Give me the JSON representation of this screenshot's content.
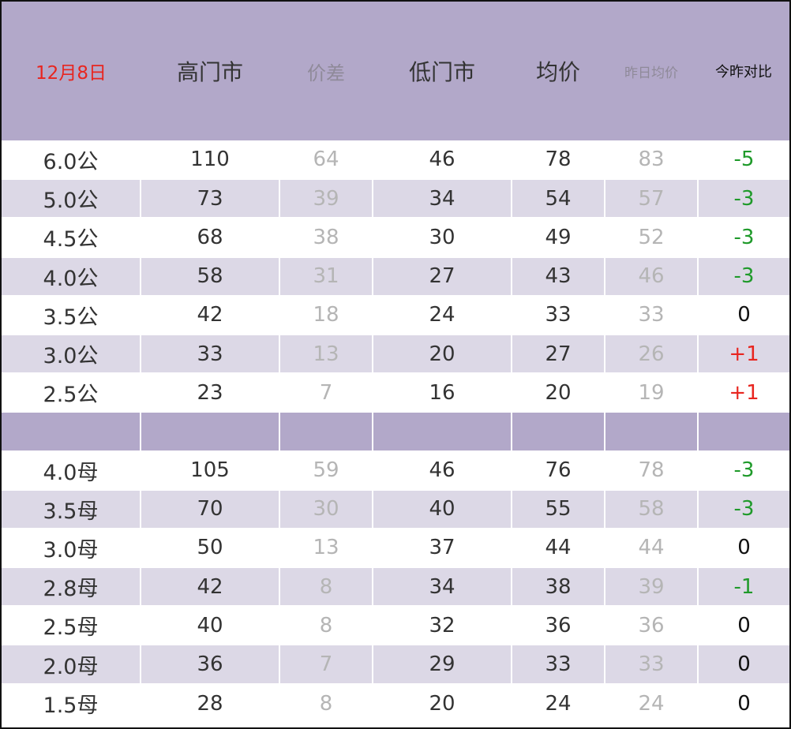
{
  "header": {
    "date": "12月8日",
    "high_market": "高门市",
    "price_diff": "价差",
    "low_market": "低门市",
    "average": "均价",
    "yesterday_avg": "昨日均价",
    "today_vs_yesterday": "今昨对比"
  },
  "colors": {
    "header_bg": "#b2a8c9",
    "alt_row_bg": "#dcd8e6",
    "date_red": "#e8251f",
    "decrease_green": "#1f9a2a",
    "increase_red": "#e8251f",
    "muted_gray": "#b5b5b5"
  },
  "male_rows": [
    {
      "spec": "6.0公",
      "high": "110",
      "diff": "64",
      "low": "46",
      "avg": "78",
      "yesterday": "83",
      "change": "-5",
      "trend": "down"
    },
    {
      "spec": "5.0公",
      "high": "73",
      "diff": "39",
      "low": "34",
      "avg": "54",
      "yesterday": "57",
      "change": "-3",
      "trend": "down"
    },
    {
      "spec": "4.5公",
      "high": "68",
      "diff": "38",
      "low": "30",
      "avg": "49",
      "yesterday": "52",
      "change": "-3",
      "trend": "down"
    },
    {
      "spec": "4.0公",
      "high": "58",
      "diff": "31",
      "low": "27",
      "avg": "43",
      "yesterday": "46",
      "change": "-3",
      "trend": "down"
    },
    {
      "spec": "3.5公",
      "high": "42",
      "diff": "18",
      "low": "24",
      "avg": "33",
      "yesterday": "33",
      "change": "0",
      "trend": "flat"
    },
    {
      "spec": "3.0公",
      "high": "33",
      "diff": "13",
      "low": "20",
      "avg": "27",
      "yesterday": "26",
      "change": "+1",
      "trend": "up"
    },
    {
      "spec": "2.5公",
      "high": "23",
      "diff": "7",
      "low": "16",
      "avg": "20",
      "yesterday": "19",
      "change": "+1",
      "trend": "up"
    }
  ],
  "female_rows": [
    {
      "spec": "4.0母",
      "high": "105",
      "diff": "59",
      "low": "46",
      "avg": "76",
      "yesterday": "78",
      "change": "-3",
      "trend": "down"
    },
    {
      "spec": "3.5母",
      "high": "70",
      "diff": "30",
      "low": "40",
      "avg": "55",
      "yesterday": "58",
      "change": "-3",
      "trend": "down"
    },
    {
      "spec": "3.0母",
      "high": "50",
      "diff": "13",
      "low": "37",
      "avg": "44",
      "yesterday": "44",
      "change": "0",
      "trend": "flat"
    },
    {
      "spec": "2.8母",
      "high": "42",
      "diff": "8",
      "low": "34",
      "avg": "38",
      "yesterday": "39",
      "change": "-1",
      "trend": "down"
    },
    {
      "spec": "2.5母",
      "high": "40",
      "diff": "8",
      "low": "32",
      "avg": "36",
      "yesterday": "36",
      "change": "0",
      "trend": "flat"
    },
    {
      "spec": "2.0母",
      "high": "36",
      "diff": "7",
      "low": "29",
      "avg": "33",
      "yesterday": "33",
      "change": "0",
      "trend": "flat"
    },
    {
      "spec": "1.5母",
      "high": "28",
      "diff": "8",
      "low": "20",
      "avg": "24",
      "yesterday": "24",
      "change": "0",
      "trend": "flat"
    }
  ]
}
